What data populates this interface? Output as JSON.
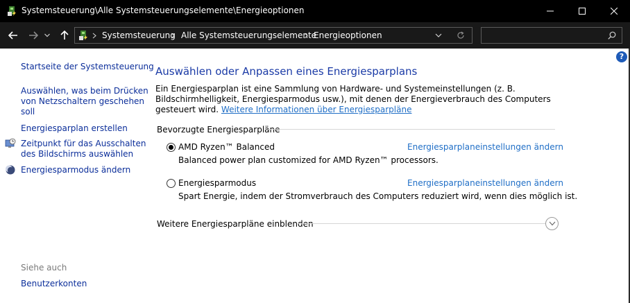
{
  "window": {
    "title": "Systemsteuerung\\Alle Systemsteuerungselemente\\Energieoptionen",
    "app_icon": "control-panel-icon",
    "controls": [
      "minimize-icon",
      "maximize-icon",
      "close-icon"
    ]
  },
  "nav": {
    "back_icon": "arrow-left-icon",
    "forward_icon": "arrow-right-icon",
    "recent_icon": "chevron-down-icon",
    "up_icon": "arrow-up-icon"
  },
  "address": {
    "breadcrumbs": [
      "Systemsteuerung",
      "Alle Systemsteuerungselemente",
      "Energieoptionen"
    ],
    "dropdown_icon": "chevron-down-icon",
    "refresh_icon": "refresh-icon"
  },
  "search": {
    "placeholder": "",
    "value": "",
    "icon": "search-icon"
  },
  "help": {
    "label": "?"
  },
  "sidebar": {
    "home_link": "Startseite der Systemsteuerung",
    "links": [
      {
        "label": "Auswählen, was beim Drücken\nvon Netzschaltern geschehen\nsoll",
        "icon": ""
      },
      {
        "label": "Energiesparplan erstellen",
        "icon": ""
      },
      {
        "label": "Zeitpunkt für das Ausschalten\ndes Bildschirms auswählen",
        "icon": "monitor-clock-icon"
      },
      {
        "label": "Energiesparmodus ändern",
        "icon": "moon-icon"
      }
    ],
    "see_also_label": "Siehe auch",
    "see_also_links": [
      "Benutzerkonten"
    ]
  },
  "main": {
    "title": "Auswählen oder Anpassen eines Energiesparplans",
    "description": "Ein Energiesparplan ist eine Sammlung von Hardware- und Systemeinstellungen (z. B. Bildschirmhelligkeit, Energiesparmodus usw.), mit denen der Energieverbrauch des Computers gesteuert wird.",
    "description_link": "Weitere Informationen über Energiesparpläne",
    "preferred_label": "Bevorzugte Energiesparpläne",
    "plans": [
      {
        "name": "AMD Ryzen™ Balanced",
        "description": "Balanced power plan customized for AMD Ryzen™ processors.",
        "selected": true,
        "settings_link": "Energiesparplaneinstellungen ändern"
      },
      {
        "name": "Energiesparmodus",
        "description": "Spart Energie, indem der Stromverbrauch des Computers reduziert wird, wenn dies möglich ist.",
        "selected": false,
        "settings_link": "Energiesparplaneinstellungen ändern"
      }
    ],
    "more_plans_label": "Weitere Energiesparpläne einblenden",
    "more_plans_icon": "chevron-down-circle-icon"
  },
  "colors": {
    "titlebar_bg": "#000000",
    "link": "#0b2e9a",
    "accent_link": "#1f6ec6",
    "heading": "#1a3aa6"
  }
}
